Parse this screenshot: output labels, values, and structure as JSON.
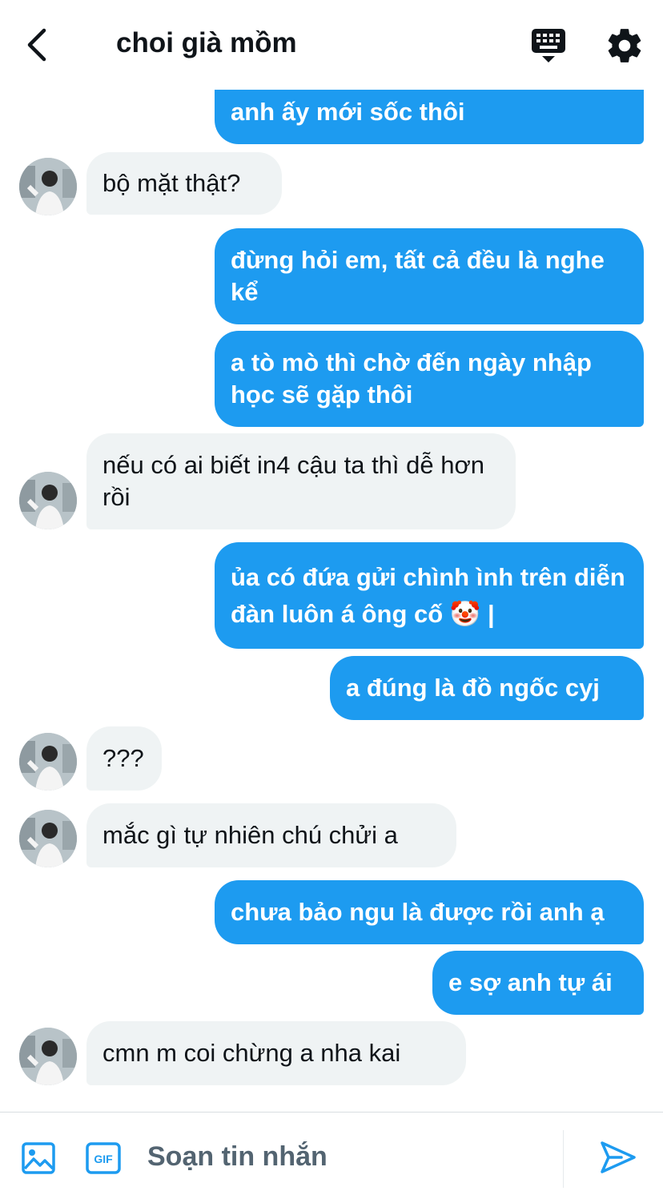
{
  "header": {
    "title": "choi già mồm"
  },
  "messages": [
    {
      "text": "anh ấy mới sốc thôi"
    },
    {
      "text": "bộ mặt thật?"
    },
    {
      "text": "đừng hỏi em, tất cả đều là nghe kể"
    },
    {
      "text": "a tò mò thì chờ đến ngày nhập học sẽ gặp thôi"
    },
    {
      "text": "nếu có ai biết in4 cậu ta thì dễ hơn rồi"
    },
    {
      "text": "ủa có đứa gửi chình ình trên diễn đàn luôn á ông cố 🤡 |"
    },
    {
      "text": "a đúng là đồ ngốc cyj"
    },
    {
      "text": "???"
    },
    {
      "text": "mắc gì tự nhiên chú chửi a"
    },
    {
      "text": "chưa bảo ngu là được rồi anh ạ"
    },
    {
      "text": "e sợ anh tự ái"
    },
    {
      "text": "cmn m coi chừng a nha kai"
    }
  ],
  "composer": {
    "placeholder": "Soạn tin nhắn"
  },
  "colors": {
    "accent": "#1d9bf0",
    "incoming_bg": "#eff3f4",
    "text": "#0f1419",
    "muted": "#536471"
  },
  "icons": [
    "back-arrow-icon",
    "keyboard-icon",
    "gear-icon",
    "image-icon",
    "gif-icon",
    "send-icon"
  ]
}
